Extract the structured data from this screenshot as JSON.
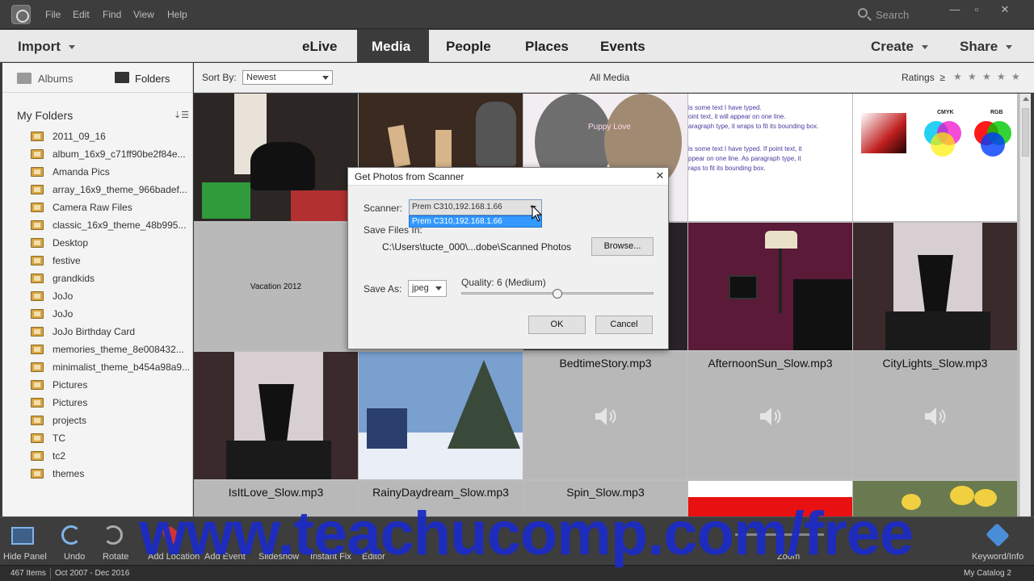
{
  "menubar": {
    "items": [
      "File",
      "Edit",
      "Find",
      "View",
      "Help"
    ],
    "search_placeholder": "Search"
  },
  "navbar": {
    "import_label": "Import",
    "tabs": [
      "eLive",
      "Media",
      "People",
      "Places",
      "Events"
    ],
    "active_tab": "Media",
    "create_label": "Create",
    "share_label": "Share"
  },
  "subbar": {
    "sortby_label": "Sort By:",
    "sortby_value": "Newest",
    "title": "All Media",
    "ratings_label": "Ratings",
    "ratings_op": "≥"
  },
  "leftpanel": {
    "albums_tab": "Albums",
    "folders_tab": "Folders",
    "section_title": "My Folders",
    "folders": [
      "2011_09_16",
      "album_16x9_c71ff90be2f84e...",
      "Amanda Pics",
      "array_16x9_theme_966badef...",
      "Camera Raw Files",
      "classic_16x9_theme_48b995...",
      "Desktop",
      "festive",
      "grandkids",
      "JoJo",
      "JoJo",
      "JoJo Birthday Card",
      "memories_theme_8e008432...",
      "minimalist_theme_b454a98a9...",
      "Pictures",
      "Pictures",
      "projects",
      "TC",
      "tc2",
      "themes"
    ]
  },
  "grid": {
    "row1_texts": {
      "puppy_caption": "Puppy Love",
      "text_doc_lines": [
        "is some text I have typed.",
        "oint text, it will appear on one line.",
        "aragraph type, it wraps to fit its bounding box.",
        "is some text I have typed. If point text, it",
        "ppear on one line. As paragraph type, it",
        "raps to fit its bounding box."
      ],
      "cmyk_label": "CMYK",
      "rgb_label": "RGB"
    },
    "vacation_label": "Vacation 2012",
    "row3_captions": [
      "BedtimeStory.mp3",
      "AfternoonSun_Slow.mp3",
      "CityLights_Slow.mp3"
    ],
    "row4_captions": [
      "IsItLove_Slow.mp3",
      "RainyDaydream_Slow.mp3",
      "Spin_Slow.mp3"
    ]
  },
  "dialog": {
    "title": "Get Photos from Scanner",
    "scanner_label": "Scanner:",
    "scanner_value": "Prem C310,192.168.1.66",
    "scanner_option": "Prem C310,192.168.1.66",
    "savefiles_label": "Save Files In:",
    "save_path": "C:\\Users\\tucte_000\\...dobe\\Scanned Photos",
    "browse_label": "Browse...",
    "saveas_label": "Save As:",
    "saveas_value": "jpeg",
    "quality_label": "Quality: 6 (Medium)",
    "quality_value": 6,
    "quality_max": 12,
    "ok_label": "OK",
    "cancel_label": "Cancel"
  },
  "toolbar": {
    "hide_panel": "Hide Panel",
    "undo": "Undo",
    "rotate": "Rotate",
    "add_location": "Add Location",
    "add_event": "Add Event",
    "slideshow": "Slideshow",
    "instant_fix": "Instant Fix",
    "editor": "Editor",
    "zoom": "Zoom",
    "keyword_info": "Keyword/Info"
  },
  "statusbar": {
    "items_count": "467 Items",
    "date_range": "Oct 2007 - Dec 2016",
    "catalog": "My Catalog 2"
  },
  "watermark": "www.teachucomp.com/free"
}
